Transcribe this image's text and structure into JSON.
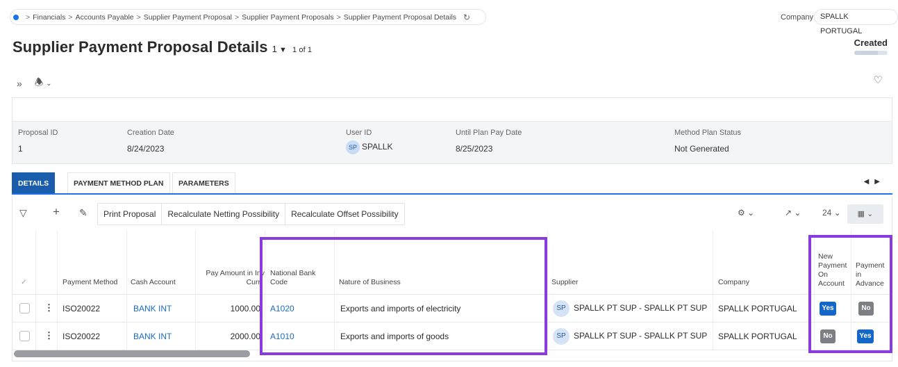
{
  "breadcrumb": {
    "items": [
      "Financials",
      "Accounts Payable",
      "Supplier Payment Proposal",
      "Supplier Payment Proposals",
      "Supplier Payment Proposal Details"
    ]
  },
  "company": {
    "label": "Company",
    "value": "SPALLK PORTUGAL"
  },
  "header": {
    "title": "Supplier Payment Proposal Details",
    "record_number": "1",
    "count": "1 of 1",
    "status": "Created",
    "status_progress": 0.7
  },
  "fields": {
    "proposal_id": {
      "label": "Proposal ID",
      "value": "1"
    },
    "creation_date": {
      "label": "Creation Date",
      "value": "8/24/2023"
    },
    "user_id": {
      "label": "User ID",
      "initials": "SP",
      "value": "SPALLK"
    },
    "until_plan_pay_date": {
      "label": "Until Plan Pay Date",
      "value": "8/25/2023"
    },
    "method_plan_status": {
      "label": "Method Plan Status",
      "value": "Not Generated"
    }
  },
  "tabs": [
    "DETAILS",
    "PAYMENT METHOD PLAN",
    "PARAMETERS"
  ],
  "toolbar": {
    "buttons": [
      "Print Proposal",
      "Recalculate Netting Possibility",
      "Recalculate Offset Possibility"
    ],
    "page_size": "24"
  },
  "table": {
    "headers": {
      "payment_method": "Payment Method",
      "cash_account": "Cash Account",
      "pay_amount_1": "Pay Amount in Inv",
      "pay_amount_2": "Curr",
      "national_bank_1": "National Bank",
      "national_bank_2": "Code",
      "nature": "Nature of Business",
      "supplier": "Supplier",
      "company": "Company",
      "new_payment_1": "New",
      "new_payment_2": "Payment",
      "new_payment_3": "On",
      "new_payment_4": "Account",
      "payment_adv_1": "Payment",
      "payment_adv_2": "in",
      "payment_adv_3": "Advance"
    },
    "rows": [
      {
        "payment_method": "ISO20022",
        "cash_account": "BANK INT",
        "amount": "1000.00",
        "bank_code": "A1020",
        "nature": "Exports and imports of electricity",
        "supplier_initials": "SP",
        "supplier": "SPALLK PT SUP - SPALLK PT SUP",
        "company": "SPALLK PORTUGAL",
        "new_payment_on_account": "Yes",
        "payment_in_advance": "No"
      },
      {
        "payment_method": "ISO20022",
        "cash_account": "BANK INT",
        "amount": "2000.00",
        "bank_code": "A1010",
        "nature": "Exports and imports of goods",
        "supplier_initials": "SP",
        "supplier": "SPALLK PT SUP - SPALLK PT SUP",
        "company": "SPALLK PORTUGAL",
        "new_payment_on_account": "No",
        "payment_in_advance": "Yes"
      }
    ]
  },
  "colors": {
    "accent": "#1a73e8",
    "highlight": "#8a3be0",
    "yes": "#1467c7",
    "no": "#7c7f84"
  }
}
